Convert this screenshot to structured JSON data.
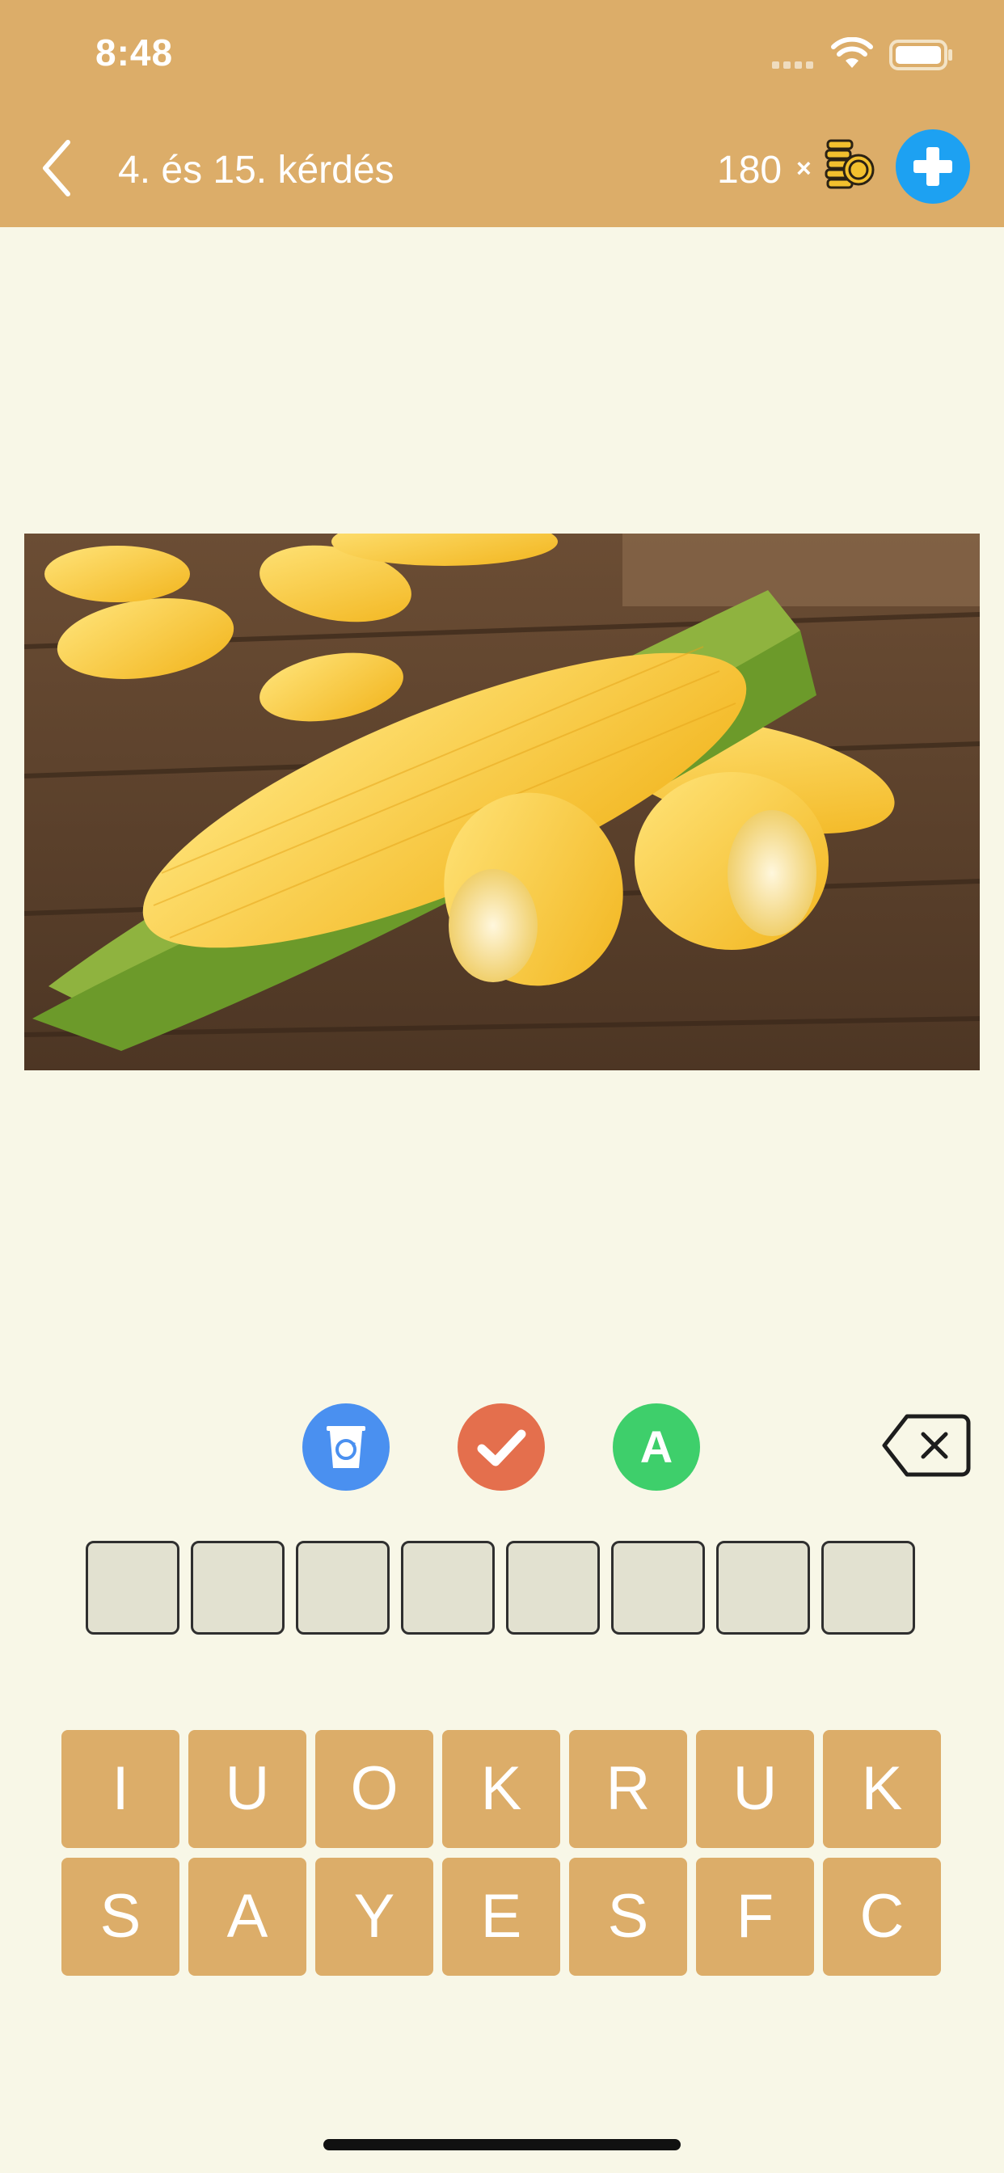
{
  "status_bar": {
    "time": "8:48"
  },
  "nav": {
    "title": "4. és 15. kérdés",
    "coins": "180",
    "coins_multiplier": "×",
    "icons": {
      "back": "chevron-left-icon",
      "coins": "coin-stack-icon",
      "add": "plus-circle-icon"
    }
  },
  "puzzle": {
    "image_subject": "corn",
    "answer_length": 8,
    "slots": [
      "",
      "",
      "",
      "",
      "",
      "",
      "",
      ""
    ]
  },
  "actions": {
    "remove_letters_icon": "recycle-bin-icon",
    "reveal_answer_icon": "checkmark-icon",
    "reveal_letter_label": "A",
    "delete_icon": "backspace-icon",
    "colors": {
      "remove": "#4a90f0",
      "reveal": "#e46f4d",
      "letter": "#3ecf6b"
    }
  },
  "keyboard": {
    "row1": [
      "I",
      "U",
      "O",
      "K",
      "R",
      "U",
      "K"
    ],
    "row2": [
      "S",
      "A",
      "Y",
      "E",
      "S",
      "F",
      "C"
    ]
  },
  "theme": {
    "header": "#dcad69",
    "background": "#f8f7e7",
    "key": "#dcad69"
  }
}
